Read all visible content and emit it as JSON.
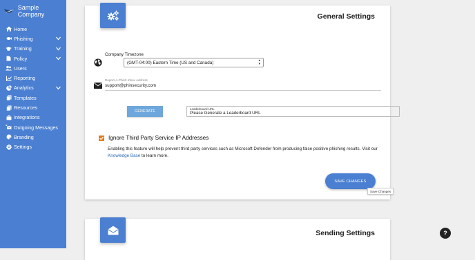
{
  "brand": {
    "name": "Sample Company"
  },
  "sidebar": {
    "items": [
      {
        "label": "Home",
        "icon": "home-icon"
      },
      {
        "label": "Phishing",
        "icon": "fish-icon",
        "expandable": true
      },
      {
        "label": "Training",
        "icon": "graduation-cap-icon",
        "expandable": true
      },
      {
        "label": "Policy",
        "icon": "file-icon",
        "expandable": true
      },
      {
        "label": "Users",
        "icon": "users-icon"
      },
      {
        "label": "Reporting",
        "icon": "chart-line-icon"
      },
      {
        "label": "Analytics",
        "icon": "pie-chart-icon",
        "expandable": true
      },
      {
        "label": "Templates",
        "icon": "copy-icon"
      },
      {
        "label": "Resources",
        "icon": "copy-icon"
      },
      {
        "label": "Integrations",
        "icon": "briefcase-icon"
      },
      {
        "label": "Outgoing Messages",
        "icon": "mail-bulk-icon"
      },
      {
        "label": "Branding",
        "icon": "palette-icon"
      },
      {
        "label": "Settings",
        "icon": "gear-icon"
      }
    ]
  },
  "general_settings": {
    "title": "General Settings",
    "timezone_label": "Company Timezone",
    "timezone_value": "(GMT-04:00) Eastern Time (US and Canada)",
    "report_inbox_label": "Report-A-Phish Inbox Address",
    "report_inbox_value": "support@phinsecurity.com",
    "generate_label": "GENERATE",
    "leaderboard_label": "Leaderboard URL",
    "leaderboard_value": "Please Generate a Leaderboard URL",
    "ignore_ip_label": "Ignore Third Party Service IP Addresses",
    "ignore_ip_checked": true,
    "description_before": "Enabling this feature will help prevent third party services such as Microsoft Defender from producing false positive phishing results. Visit our ",
    "description_link": "Knowledge Base",
    "description_after": " to learn more.",
    "save_label": "SAVE CHANGES",
    "save_tooltip": "Save Changes"
  },
  "sending_settings": {
    "title": "Sending Settings"
  },
  "help": {
    "label": "?"
  },
  "colors": {
    "accent": "#4a7fd1",
    "checkbox": "#e07a1c",
    "link": "#2a67b8"
  }
}
